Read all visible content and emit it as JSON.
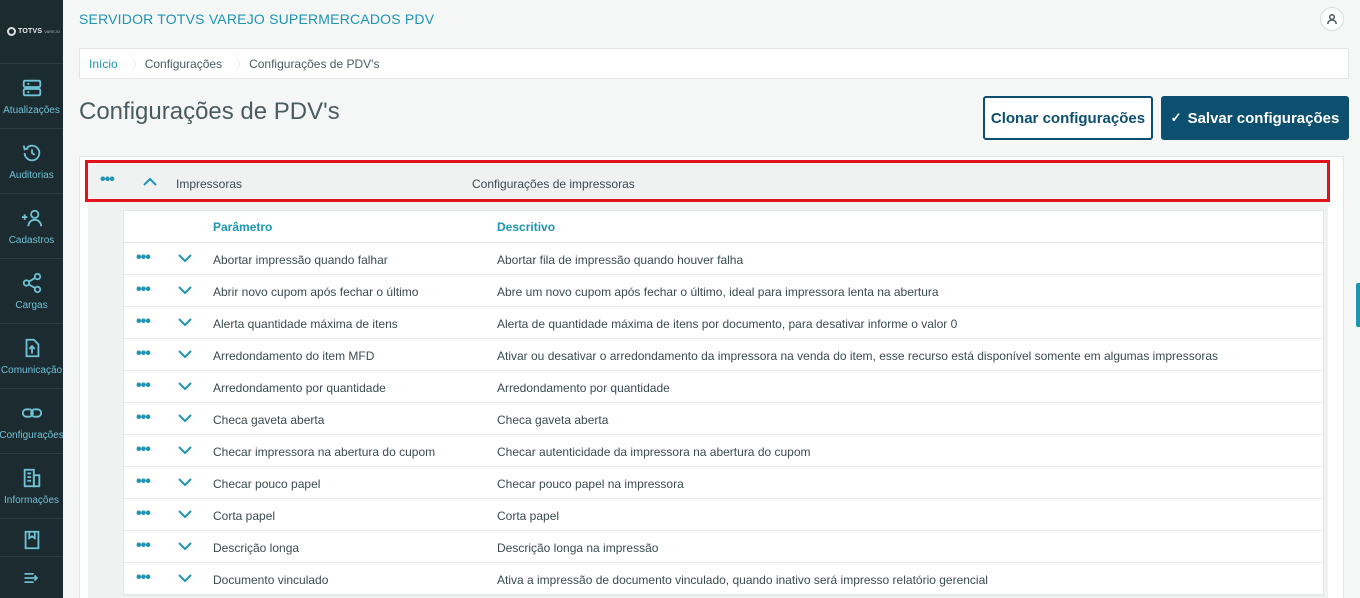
{
  "logo": {
    "text": "TOTVS",
    "sub": "VAREJO"
  },
  "sidebar": {
    "items": [
      {
        "label": "Atualizações",
        "icon": "server-icon"
      },
      {
        "label": "Auditorias",
        "icon": "history-icon"
      },
      {
        "label": "Cadastros",
        "icon": "add-user-icon"
      },
      {
        "label": "Cargas",
        "icon": "share-icon"
      },
      {
        "label": "Comunicação",
        "icon": "file-upload-icon"
      },
      {
        "label": "Configurações",
        "icon": "link-icon"
      },
      {
        "label": "Informações",
        "icon": "building-icon"
      },
      {
        "label": "",
        "icon": "book-icon"
      }
    ]
  },
  "header": {
    "title": "SERVIDOR TOTVS VAREJO SUPERMERCADOS PDV"
  },
  "breadcrumb": [
    "Início",
    "Configurações",
    "Configurações de PDV's"
  ],
  "page": {
    "title": "Configurações de PDV's",
    "clone_label": "Clonar configurações",
    "save_label": "Salvar configurações"
  },
  "group": {
    "name": "Impressoras",
    "description": "Configurações de impressoras"
  },
  "table": {
    "headers": {
      "param": "Parâmetro",
      "desc": "Descritivo"
    },
    "rows": [
      {
        "param": "Abortar impressão quando falhar",
        "desc": "Abortar fila de impressão quando houver falha"
      },
      {
        "param": "Abrir novo cupom após fechar o último",
        "desc": "Abre um novo cupom após fechar o último, ideal para impressora lenta na abertura"
      },
      {
        "param": "Alerta quantidade máxima de itens",
        "desc": "Alerta de quantidade máxima de itens por documento, para desativar informe o valor 0"
      },
      {
        "param": "Arredondamento do item MFD",
        "desc": "Ativar ou desativar o arredondamento da impressora na venda do item, esse recurso está disponível somente em algumas impressoras"
      },
      {
        "param": "Arredondamento por quantidade",
        "desc": "Arredondamento por quantidade"
      },
      {
        "param": "Checa gaveta aberta",
        "desc": "Checa gaveta aberta"
      },
      {
        "param": "Checar impressora na abertura do cupom",
        "desc": "Checar autenticidade da impressora na abertura do cupom"
      },
      {
        "param": "Checar pouco papel",
        "desc": "Checar pouco papel na impressora"
      },
      {
        "param": "Corta papel",
        "desc": "Corta papel"
      },
      {
        "param": "Descrição longa",
        "desc": "Descrição longa na impressão"
      },
      {
        "param": "Documento vinculado",
        "desc": "Ativa a impressão de documento vinculado, quando inativo será impresso relatório gerencial"
      }
    ]
  },
  "colors": {
    "accent": "#1d95b3",
    "primary": "#0c4f6e",
    "sidebar": "#1c2b30",
    "highlight": "#e2111b"
  }
}
